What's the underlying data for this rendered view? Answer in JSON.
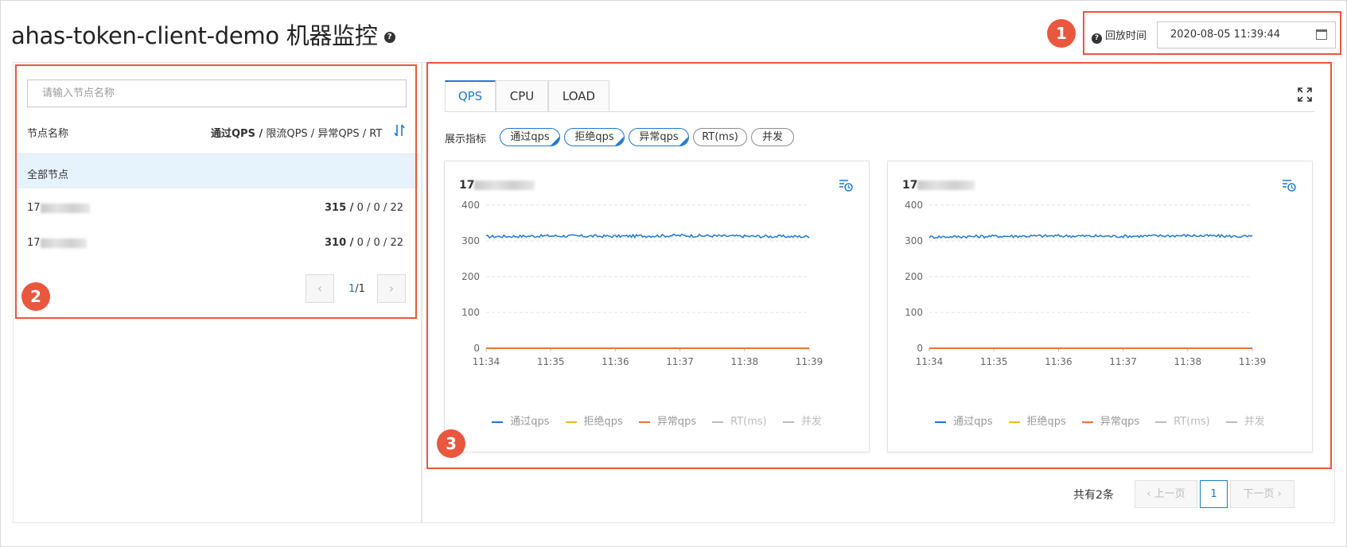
{
  "page": {
    "title": "ahas-token-client-demo 机器监控",
    "help_icon": "question-circle-icon"
  },
  "replay": {
    "label": "回放时间",
    "value": "2020-08-05 11:39:44",
    "icon": "calendar-icon"
  },
  "badges": [
    "1",
    "2",
    "3"
  ],
  "node_panel": {
    "search_placeholder": "请输入节点名称",
    "col_name": "节点名称",
    "col_metrics_bold": "通过QPS /",
    "col_metrics_rest": " 限流QPS /  异常QPS /  RT",
    "rows": [
      {
        "name": "全部节点",
        "pass": "",
        "block": "",
        "exception": "",
        "rt": ""
      },
      {
        "name": "17",
        "pass": "315 /",
        "block": "0 /",
        "exception": "0 /",
        "rt": "22"
      },
      {
        "name": "17",
        "pass": "310 /",
        "block": "0 /",
        "exception": "0 /",
        "rt": "22"
      }
    ],
    "page_info": "1/1",
    "prev_symbol": "‹",
    "next_symbol": "›"
  },
  "tabs": [
    "QPS",
    "CPU",
    "LOAD"
  ],
  "active_tab": "QPS",
  "metrics": {
    "label": "展示指标",
    "items": [
      {
        "label": "通过qps",
        "selected": true
      },
      {
        "label": "拒绝qps",
        "selected": true
      },
      {
        "label": "异常qps",
        "selected": true
      },
      {
        "label": "RT(ms)",
        "selected": false
      },
      {
        "label": "并发",
        "selected": false
      }
    ]
  },
  "legend": [
    {
      "label": "通过qps",
      "color": "#1e78d3"
    },
    {
      "label": "拒绝qps",
      "color": "#f5b70e"
    },
    {
      "label": "异常qps",
      "color": "#f0703c"
    },
    {
      "label": "RT(ms)",
      "color": "#bbbbbb"
    },
    {
      "label": "并发",
      "color": "#bbbbbb"
    }
  ],
  "cards": [
    {
      "title": "17"
    },
    {
      "title": "17"
    }
  ],
  "chart_data": [
    {
      "type": "line",
      "x": [
        "11:34",
        "11:35",
        "11:36",
        "11:37",
        "11:38",
        "11:39"
      ],
      "yticks": [
        0,
        100,
        200,
        300,
        400
      ],
      "ylim": [
        0,
        400
      ],
      "grid": true,
      "legend_position": "bottom",
      "series": [
        {
          "name": "通过qps",
          "values": [
            312,
            314,
            313,
            315,
            313,
            312
          ]
        },
        {
          "name": "拒绝qps",
          "values": [
            0,
            0,
            0,
            0,
            0,
            0
          ]
        },
        {
          "name": "异常qps",
          "values": [
            0,
            0,
            0,
            0,
            0,
            0
          ]
        }
      ]
    },
    {
      "type": "line",
      "x": [
        "11:34",
        "11:35",
        "11:36",
        "11:37",
        "11:38",
        "11:39"
      ],
      "yticks": [
        0,
        100,
        200,
        300,
        400
      ],
      "ylim": [
        0,
        400
      ],
      "grid": true,
      "legend_position": "bottom",
      "series": [
        {
          "name": "通过qps",
          "values": [
            311,
            313,
            314,
            313,
            315,
            312
          ]
        },
        {
          "name": "拒绝qps",
          "values": [
            0,
            0,
            0,
            0,
            0,
            0
          ]
        },
        {
          "name": "异常qps",
          "values": [
            0,
            0,
            0,
            0,
            0,
            0
          ]
        }
      ]
    }
  ],
  "pagination": {
    "total": "共有2条",
    "prev": "上一页",
    "current": "1",
    "next": "下一页"
  }
}
